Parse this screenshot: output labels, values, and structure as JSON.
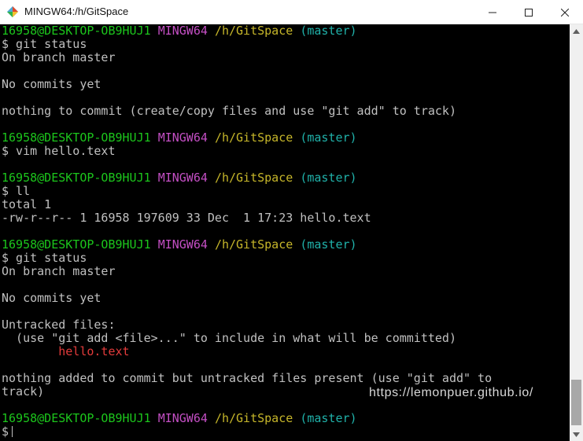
{
  "window": {
    "title": "MINGW64:/h/GitSpace",
    "icons": {
      "app": "git-bash-icon",
      "minimize": "minimize-icon",
      "maximize": "maximize-icon",
      "close": "close-icon"
    }
  },
  "terminal": {
    "prompt": {
      "user_host": "16958@DESKTOP-OB9HUJ1",
      "system": "MINGW64",
      "path": "/h/GitSpace",
      "branch": "(master)"
    },
    "lines": [
      "$ git status",
      "On branch master",
      "No commits yet",
      "nothing to commit (create/copy files and use \"git add\" to track)",
      "$ vim hello.text",
      "$ ll",
      "total 1",
      "-rw-r--r-- 1 16958 197609 33 Dec  1 17:23 hello.text",
      "$ git status",
      "On branch master",
      "No commits yet",
      "Untracked files:",
      "  (use \"git add <file>...\" to include in what will be committed)",
      "        hello.text",
      "nothing added to commit but untracked files present (use \"git add\" to",
      "track)",
      "$"
    ],
    "watermark": "https://lemonpuer.github.io/"
  },
  "colors": {
    "green": "#1cc61c",
    "magenta": "#c44fc4",
    "yellow": "#c6b62a",
    "cyan": "#20b2aa",
    "red": "#e33b3b",
    "text": "#c0c0c0"
  }
}
